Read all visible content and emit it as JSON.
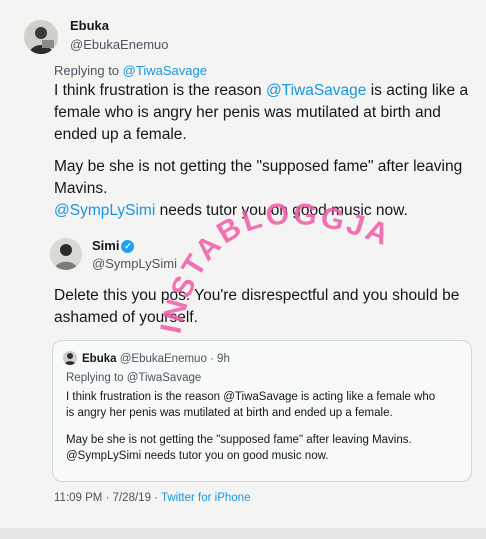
{
  "tweet": {
    "name": "Ebuka",
    "handle": "@EbukaEnemuo",
    "replying_prefix": "Replying to",
    "replying_to": "@TiwaSavage",
    "para1_a": "I think frustration is the reason ",
    "para1_mention": "@TiwaSavage",
    "para1_b": " is acting like a",
    "para1_line2": "female who is angry her penis was mutilated at birth and",
    "para1_line3": "ended up a female.",
    "para2_line1": "May be she is not getting the \"supposed fame\" after leaving",
    "para2_line2": "Mavins.",
    "para3_mention": "@SympLySimi",
    "para3_rest": " needs tutor you on good music now."
  },
  "reply": {
    "name": "Simi",
    "verified_glyph": "✓",
    "handle": "@SympLySimi",
    "line1": "Delete this you pos. You're disrespectful and you should be",
    "line2": "ashamed of yourself."
  },
  "quote": {
    "name": "Ebuka",
    "handle_time": "@EbukaEnemuo · 9h",
    "replying": "Replying to @TiwaSavage",
    "p1_line1": "I think frustration is the reason @TiwaSavage is acting like a female who",
    "p1_line2": "is angry her penis was mutilated at birth and ended up a female.",
    "p2_line1": "May be she is not getting the \"supposed fame\" after leaving Mavins.",
    "p2_line2": "@SympLySimi needs tutor you on good music now."
  },
  "meta": {
    "timestamp": "11:09 PM · 7/28/19 · ",
    "source": "Twitter for iPhone"
  },
  "watermark": {
    "text": "INSTABLOGGJA",
    "color": "#ee5aa6"
  },
  "colors": {
    "link": "#1b95e0",
    "verified": "#1da1f2"
  }
}
